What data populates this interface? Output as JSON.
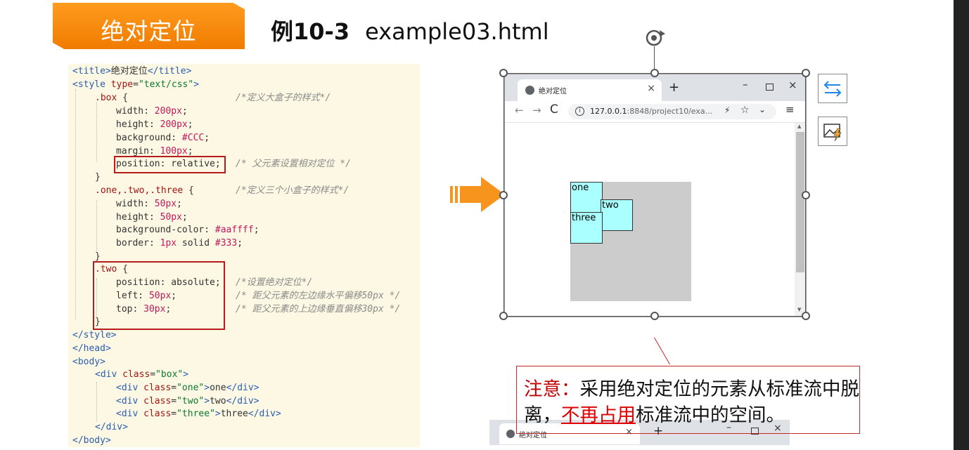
{
  "slide": {
    "section_title": "绝对定位",
    "example_label": "例10-3",
    "example_file": "example03.html"
  },
  "code": {
    "l1_open": "<title>",
    "l1_text": "绝对定位",
    "l1_close": "</title>",
    "l2_tag": "<style ",
    "l2_attr": "type",
    "l2_val": "\"text/css\"",
    "l2_end": ">",
    "l3_sel": ".box",
    "l3_brace": " {",
    "c3": "/*定义大盒子的样式*/",
    "l4_prop": "width: ",
    "l4_num": "200px",
    "l4_end": ";",
    "l5_prop": "height: ",
    "l5_num": "200px",
    "l5_end": ";",
    "l6_prop": "background: ",
    "l6_num": "#CCC",
    "l6_end": ";",
    "l7_prop": "margin: ",
    "l7_num": "100px",
    "l7_end": ";",
    "l8_text": "position: relative;",
    "c8": "/* 父元素设置相对定位 */",
    "l9": "}",
    "l10_sel": ".one,.two,.three",
    "l10_brace": " {",
    "c10": "/*定义三个小盒子的样式*/",
    "l11_prop": "width: ",
    "l11_num": "50px",
    "l11_end": ";",
    "l12_prop": "height: ",
    "l12_num": "50px",
    "l12_end": ";",
    "l13_prop": "background-color: ",
    "l13_num": "#aaffff",
    "l13_end": ";",
    "l14_prop": "border: ",
    "l14_num": "1px",
    "l14_mid": " solid ",
    "l14_num2": "#333",
    "l14_end": ";",
    "l15": "}",
    "l16_sel": ".two",
    "l16_brace": " {",
    "l17_text": "position: absolute;",
    "c17": "/*设置绝对定位*/",
    "l18_prop": "left: ",
    "l18_num": "50px",
    "l18_end": ";",
    "c18": "/* 距父元素的左边缘水平偏移50px */",
    "l19_prop": "top: ",
    "l19_num": "30px",
    "l19_end": ";",
    "c19": "/* 距父元素的上边缘垂直偏移30px */",
    "l20": "}",
    "l21": "</style>",
    "l22": "</head>",
    "l23": "<body>",
    "l24_tag": "<div ",
    "l24_attr": "class",
    "l24_eq": "=",
    "l24_val": "\"box\"",
    "l24_end": ">",
    "l25_tag": "<div ",
    "l25_attr": "class",
    "l25_eq": "=",
    "l25_val": "\"one\"",
    "l25_gt": ">",
    "l25_text": "one",
    "l25_close": "</div>",
    "l26_tag": "<div ",
    "l26_attr": "class",
    "l26_eq": "=",
    "l26_val": "\"two\"",
    "l26_gt": ">",
    "l26_text": "two",
    "l26_close": "</div>",
    "l27_tag": "<div ",
    "l27_attr": "class",
    "l27_eq": "=",
    "l27_val": "\"three\"",
    "l27_gt": ">",
    "l27_text": "three",
    "l27_close": "</div>",
    "l28": "</div>",
    "l29": "</body>"
  },
  "browser": {
    "tab_title": "绝对定位",
    "tab_close": "×",
    "new_tab": "+",
    "win_min": "–",
    "win_close": "×",
    "back": "←",
    "forward": "→",
    "reload": "C",
    "info": "i",
    "url_host": "127.0.0.1",
    "url_rest": ":8848/project10/exa...",
    "bolt": "⚡",
    "star": "☆",
    "chevron": "⌄",
    "menu": "≡",
    "box_one": "one",
    "box_two": "two",
    "box_three": "three"
  },
  "callout": {
    "label": "注意",
    "colon": "：",
    "text1": "采用绝对定位的元素从标准流中脱离，",
    "emphasis": "不再占用",
    "text2": "标准流中的空间。"
  },
  "browser2": {
    "tab_title": "绝对定位",
    "tab_close": "×",
    "new_tab": "+",
    "win_min": "–",
    "win_close": "×"
  }
}
